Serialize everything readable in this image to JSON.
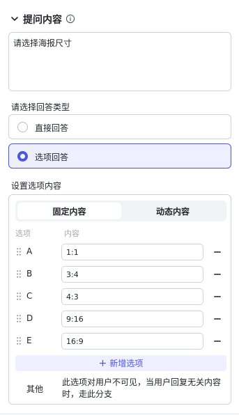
{
  "section": {
    "title": "提问内容",
    "chevron_icon": "chevron-down-icon",
    "info_icon": "info-icon"
  },
  "prompt": {
    "value": "请选择海报尺寸"
  },
  "answer_type": {
    "label": "请选择回答类型",
    "options": [
      {
        "label": "直接回答",
        "selected": false
      },
      {
        "label": "选项回答",
        "selected": true
      }
    ]
  },
  "options_config": {
    "label": "设置选项内容",
    "tabs": [
      {
        "label": "固定内容",
        "active": true
      },
      {
        "label": "动态内容",
        "active": false
      }
    ],
    "columns": {
      "key": "选项",
      "content": "内容"
    },
    "rows": [
      {
        "key": "A",
        "value": "1:1"
      },
      {
        "key": "B",
        "value": "3:4"
      },
      {
        "key": "C",
        "value": "4:3"
      },
      {
        "key": "D",
        "value": "9:16"
      },
      {
        "key": "E",
        "value": "16:9"
      }
    ],
    "add_label": "新增选项",
    "other": {
      "label": "其他",
      "description": "此选项对用户不可见，当用户回复无关内容时，走此分支"
    }
  },
  "colors": {
    "accent": "#4d53e8",
    "accent_bg": "#eef0ff",
    "border": "#d0d3d6"
  }
}
